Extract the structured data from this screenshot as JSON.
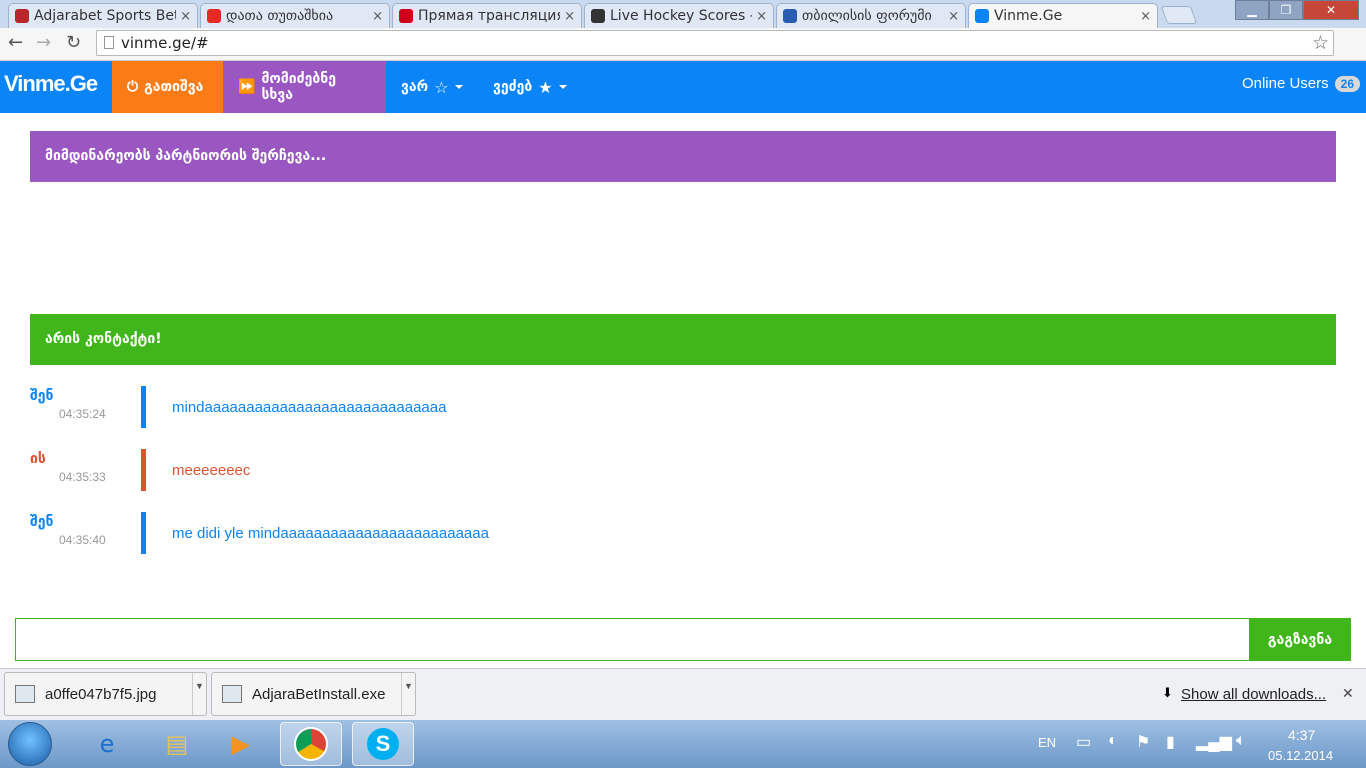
{
  "browser": {
    "tabs": [
      {
        "title": "Adjarabet Sports Bet",
        "favicon_color": "#b7262a"
      },
      {
        "title": "დათა თუთაშხია",
        "favicon_color": "#e52d27"
      },
      {
        "title": "Прямая трансляция",
        "favicon_color": "#d0021b"
      },
      {
        "title": "Live Hockey Scores -",
        "favicon_color": "#333333"
      },
      {
        "title": "თბილისის ფორუმი",
        "favicon_color": "#2a5db0"
      },
      {
        "title": "Vinme.Ge",
        "favicon_color": "#0b84f7"
      }
    ],
    "url": "vinme.ge/#"
  },
  "app": {
    "logo": "Vinme.Ge",
    "nav": {
      "disconnect": "გათიშვა",
      "next_partner": "მომიძებნე სხვა",
      "i_am": "ვარ",
      "i_seek": "ვეძებ"
    },
    "online_label": "Online Users",
    "online_count": "26",
    "search_banner": "მიმდინარეობს პარტნიორის შერჩევა...",
    "connected_banner": "არის კონტაქტი!",
    "messages": [
      {
        "who": "შენ",
        "time": "04:35:24",
        "text": "mindaaaaaaaaaaaaaaaaaaaaaaaaaaaaa"
      },
      {
        "who": "ის",
        "time": "04:35:33",
        "text": "meeeeeeec"
      },
      {
        "who": "შენ",
        "time": "04:35:40",
        "text": "me didi yle mindaaaaaaaaaaaaaaaaaaaaaaaaa"
      }
    ],
    "send_label": "გაგზავნა",
    "colors": {
      "blue": "#0b84f7",
      "orange": "#fb7c17",
      "purple": "#9a57c2",
      "green": "#41b61a",
      "red": "#d9542f"
    }
  },
  "downloads": {
    "items": [
      "a0ffe047b7f5.jpg",
      "AdjaraBetInstall.exe"
    ],
    "show_all": "Show all downloads..."
  },
  "taskbar": {
    "lang": "EN",
    "time": "4:37",
    "date": "05.12.2014"
  }
}
